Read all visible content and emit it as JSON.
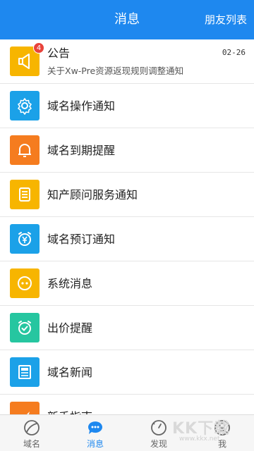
{
  "header": {
    "title": "消息",
    "right_link": "朋友列表"
  },
  "colors": {
    "header_bg": "#1e88ef",
    "notice_icon": "#f7b500",
    "domain_op_icon": "#1ba1e8",
    "expiry_icon": "#f57c1f",
    "ip_icon": "#f7b500",
    "reserve_icon": "#1ba1e8",
    "system_icon": "#f7b500",
    "bid_icon": "#26c6a0",
    "news_icon": "#1ba1e8",
    "guide_icon": "#f57c1f",
    "badge": "#e8433b",
    "tab_active": "#1e88ef"
  },
  "messages": [
    {
      "label": "公告",
      "subtitle": "关于Xw-Pre资源返现规则调整通知",
      "date": "02-26",
      "badge": "4",
      "icon": "megaphone-icon"
    },
    {
      "label": "域名操作通知",
      "icon": "gear-icon"
    },
    {
      "label": "域名到期提醒",
      "icon": "bell-icon"
    },
    {
      "label": "知产顾问服务通知",
      "icon": "list-icon"
    },
    {
      "label": "域名预订通知",
      "icon": "yen-alarm-icon"
    },
    {
      "label": "系统消息",
      "icon": "dots-icon"
    },
    {
      "label": "出价提醒",
      "icon": "check-clock-icon"
    },
    {
      "label": "域名新闻",
      "icon": "news-icon"
    },
    {
      "label": "新手指南",
      "icon": "guide-icon"
    }
  ],
  "tabbar": [
    {
      "label": "域名",
      "icon": "domain-globe-icon",
      "active": false
    },
    {
      "label": "消息",
      "icon": "chat-bubble-icon",
      "active": true
    },
    {
      "label": "发现",
      "icon": "compass-icon",
      "active": false
    },
    {
      "label": "我",
      "icon": "person-icon",
      "active": false
    }
  ],
  "watermark": {
    "text": "KK下载",
    "url": "www.kkx.net"
  }
}
